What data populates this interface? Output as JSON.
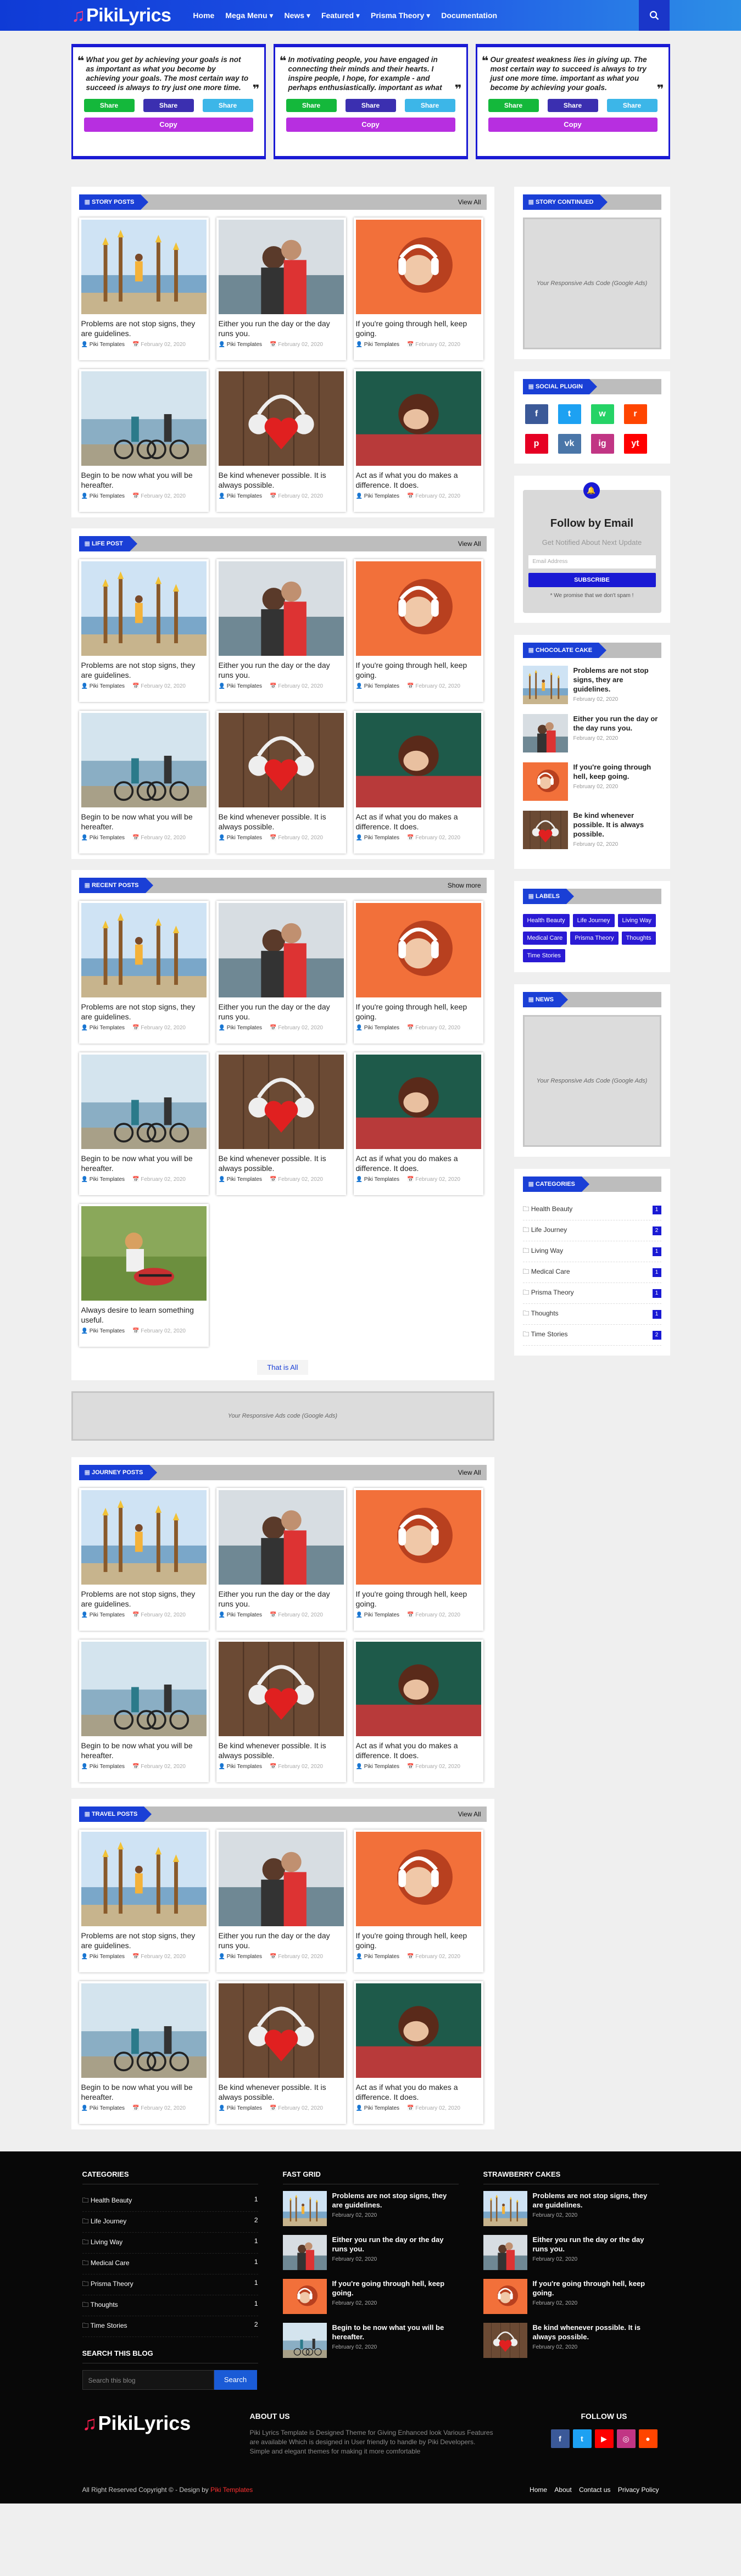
{
  "header": {
    "logo_text": "PikiLyrics",
    "nav": [
      "Home",
      "Mega Menu ▾",
      "News ▾",
      "Featured ▾",
      "Prisma Theory ▾",
      "Documentation"
    ]
  },
  "quotes": [
    {
      "text": "What you get by achieving your goals is not as important as what you become by achieving your goals. The most certain way to succeed is always to try just one more time.",
      "wa": "Share",
      "fb": "Share",
      "tw": "Share",
      "copy": "Copy"
    },
    {
      "text": "In motivating people, you have engaged in connecting their minds and their hearts. I inspire people, I hope, for example - and perhaps enthusiastically. important as what you become by",
      "wa": "Share",
      "fb": "Share",
      "tw": "Share",
      "copy": "Copy"
    },
    {
      "text": "Our greatest weakness lies in giving up. The most certain way to succeed is always to try just one more time. important as what you become by achieving your goals.",
      "wa": "Share",
      "fb": "Share",
      "tw": "Share",
      "copy": "Copy"
    }
  ],
  "posts": [
    {
      "title": "Problems are not stop signs, they are guidelines.",
      "author": "Piki Templates",
      "date": "February 02, 2020"
    },
    {
      "title": "Either you run the day or the day runs you.",
      "author": "Piki Templates",
      "date": "February 02, 2020"
    },
    {
      "title": "If you're going through hell, keep going.",
      "author": "Piki Templates",
      "date": "February 02, 2020"
    },
    {
      "title": "Begin to be now what you will be hereafter.",
      "author": "Piki Templates",
      "date": "February 02, 2020"
    },
    {
      "title": "Be kind whenever possible. It is always possible.",
      "author": "Piki Templates",
      "date": "February 02, 2020"
    },
    {
      "title": "Act as if what you do makes a difference. It does.",
      "author": "Piki Templates",
      "date": "February 02, 2020"
    },
    {
      "title": "Always desire to learn something useful.",
      "author": "Piki Templates",
      "date": "February 02, 2020"
    }
  ],
  "sections": {
    "story": {
      "title": "STORY POSTS",
      "link": "View All"
    },
    "life": {
      "title": "LIFE POST",
      "link": "View All"
    },
    "recent": {
      "title": "RECENT POSTS",
      "link": "Show more",
      "that_all": "That is All"
    },
    "ad_wide": "Your Responsive Ads code (Google Ads)",
    "journey": {
      "title": "JOURNEY POSTS",
      "link": "View All"
    },
    "travel": {
      "title": "TRAVEL POSTS",
      "link": "View All"
    }
  },
  "sidebar": {
    "story_continued": {
      "title": "STORY CONTINUED",
      "ad": "Your Responsive Ads Code (Google Ads)"
    },
    "social": {
      "title": "SOCIAL PLUGIN",
      "icons": [
        "f",
        "t",
        "w",
        "r",
        "p",
        "vk",
        "ig",
        "yt"
      ]
    },
    "follow": {
      "heading": "Follow by Email",
      "text": "Get Notified About Next Update",
      "placeholder": "Email Address",
      "button": "SUBSCRIBE",
      "promise": "* We promise that we don't spam !"
    },
    "chocolate": {
      "title": "CHOCOLATE CAKE",
      "items": [
        {
          "title": "Problems are not stop signs, they are guidelines.",
          "date": "February 02, 2020"
        },
        {
          "title": "Either you run the day or the day runs you.",
          "date": "February 02, 2020"
        },
        {
          "title": "If you're going through hell, keep going.",
          "date": "February 02, 2020"
        },
        {
          "title": "Be kind whenever possible. It is always possible.",
          "date": "February 02, 2020"
        }
      ]
    },
    "labels": {
      "title": "LABELS",
      "items": [
        "Health Beauty",
        "Life Journey",
        "Living Way",
        "Medical Care",
        "Prisma Theory",
        "Thoughts",
        "Time Stories"
      ]
    },
    "news": {
      "title": "NEWS",
      "ad": "Your Responsive Ads Code (Google Ads)"
    },
    "categories": {
      "title": "CATEGORIES",
      "items": [
        {
          "name": "Health Beauty",
          "count": "1"
        },
        {
          "name": "Life Journey",
          "count": "2"
        },
        {
          "name": "Living Way",
          "count": "1"
        },
        {
          "name": "Medical Care",
          "count": "1"
        },
        {
          "name": "Prisma Theory",
          "count": "1"
        },
        {
          "name": "Thoughts",
          "count": "1"
        },
        {
          "name": "Time Stories",
          "count": "2"
        }
      ]
    }
  },
  "footer": {
    "categories_title": "CATEGORIES",
    "categories": [
      {
        "name": "Health Beauty",
        "count": "1"
      },
      {
        "name": "Life Journey",
        "count": "2"
      },
      {
        "name": "Living Way",
        "count": "1"
      },
      {
        "name": "Medical Care",
        "count": "1"
      },
      {
        "name": "Prisma Theory",
        "count": "1"
      },
      {
        "name": "Thoughts",
        "count": "1"
      },
      {
        "name": "Time Stories",
        "count": "2"
      }
    ],
    "search_title": "SEARCH THIS BLOG",
    "search_placeholder": "Search this blog",
    "search_button": "Search",
    "fast_grid_title": "FAST GRID",
    "fast_grid": [
      {
        "title": "Problems are not stop signs, they are guidelines.",
        "date": "February 02, 2020"
      },
      {
        "title": "Either you run the day or the day runs you.",
        "date": "February 02, 2020"
      },
      {
        "title": "If you're going through hell, keep going.",
        "date": "February 02, 2020"
      },
      {
        "title": "Begin to be now what you will be hereafter.",
        "date": "February 02, 2020"
      }
    ],
    "straw_title": "STRAWBERRY CAKES",
    "straw": [
      {
        "title": "Problems are not stop signs, they are guidelines.",
        "date": "February 02, 2020"
      },
      {
        "title": "Either you run the day or the day runs you.",
        "date": "February 02, 2020"
      },
      {
        "title": "If you're going through hell, keep going.",
        "date": "February 02, 2020"
      },
      {
        "title": "Be kind whenever possible. It is always possible.",
        "date": "February 02, 2020"
      }
    ],
    "logo_text": "PikiLyrics",
    "about_title": "ABOUT US",
    "about_text": "Piki Lyrics Template is Designed Theme for Giving Enhanced look Various Features are available Which is designed in User friendly to handle by Piki Developers. Simple and elegant themes for making it more comfortable",
    "follow_title": "FOLLOW US",
    "copyright_prefix": "All Right Reserved Copyright © - Design by",
    "copyright_brand": "Piki Templates",
    "links": [
      "Home",
      "About",
      "Contact us",
      "Privacy Policy"
    ]
  }
}
